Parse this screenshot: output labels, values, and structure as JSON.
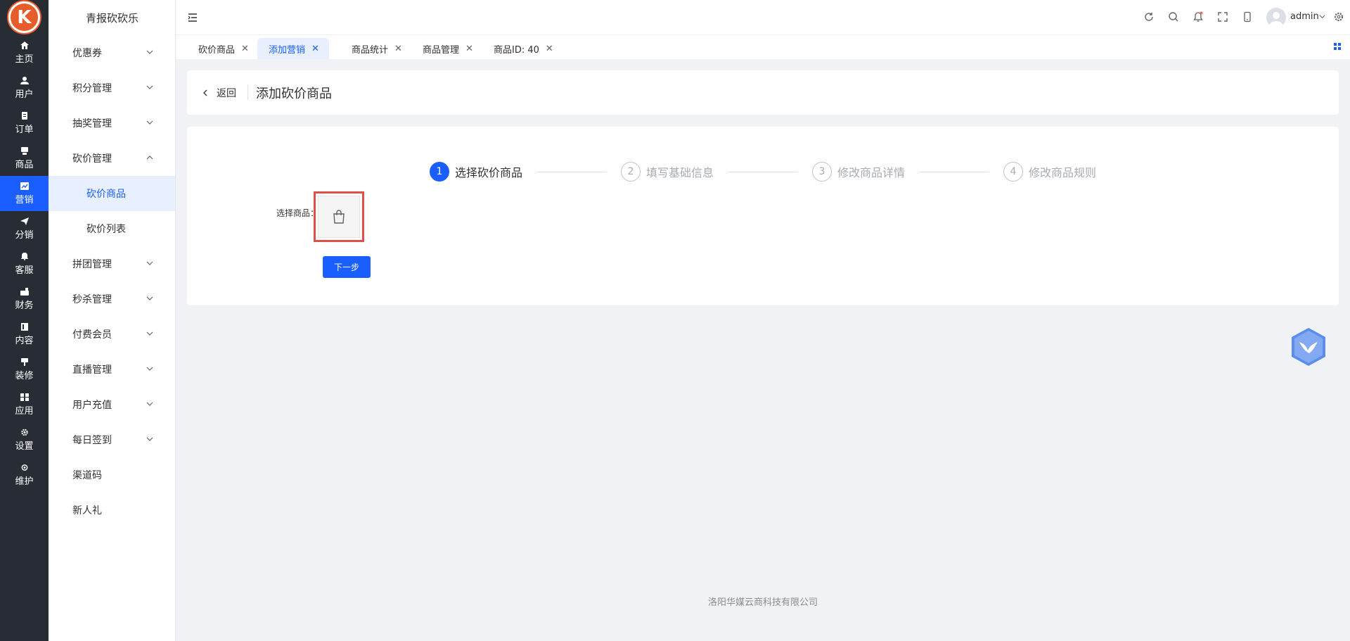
{
  "rail": {
    "logo_text": "K",
    "items": [
      {
        "label": "主页",
        "icon": "home-icon"
      },
      {
        "label": "用户",
        "icon": "user-icon"
      },
      {
        "label": "订单",
        "icon": "order-icon"
      },
      {
        "label": "商品",
        "icon": "product-icon"
      },
      {
        "label": "营销",
        "icon": "marketing-icon"
      },
      {
        "label": "分销",
        "icon": "distribution-icon"
      },
      {
        "label": "客服",
        "icon": "service-icon"
      },
      {
        "label": "财务",
        "icon": "finance-icon"
      },
      {
        "label": "内容",
        "icon": "content-icon"
      },
      {
        "label": "装修",
        "icon": "decorate-icon"
      },
      {
        "label": "应用",
        "icon": "apps-icon"
      },
      {
        "label": "设置",
        "icon": "settings-icon"
      },
      {
        "label": "维护",
        "icon": "maintenance-icon"
      }
    ]
  },
  "submenu": {
    "brand": "青报砍砍乐",
    "items": [
      {
        "label": "优惠券"
      },
      {
        "label": "积分管理"
      },
      {
        "label": "抽奖管理"
      },
      {
        "label": "砍价管理"
      },
      {
        "label": "砍价商品"
      },
      {
        "label": "砍价列表"
      },
      {
        "label": "拼团管理"
      },
      {
        "label": "秒杀管理"
      },
      {
        "label": "付费会员"
      },
      {
        "label": "直播管理"
      },
      {
        "label": "用户充值"
      },
      {
        "label": "每日签到"
      },
      {
        "label": "渠道码"
      },
      {
        "label": "新人礼"
      }
    ]
  },
  "header": {
    "user_name": "admin"
  },
  "tabs": [
    {
      "label": "砍价商品"
    },
    {
      "label": "添加营销"
    },
    {
      "label": "商品统计"
    },
    {
      "label": "商品管理"
    },
    {
      "label": "商品ID: 40"
    }
  ],
  "page": {
    "back_label": "返回",
    "title": "添加砍价商品"
  },
  "steps": [
    {
      "num": "1",
      "label": "选择砍价商品"
    },
    {
      "num": "2",
      "label": "填写基础信息"
    },
    {
      "num": "3",
      "label": "修改商品详情"
    },
    {
      "num": "4",
      "label": "修改商品规则"
    }
  ],
  "form": {
    "select_label": "选择商品：",
    "next_button": "下一步"
  },
  "footer": {
    "company": "洛阳华媒云商科技有限公司"
  },
  "colors": {
    "accent": "#1a5eff",
    "rail_bg": "#282c34",
    "highlight_border": "#e0504a"
  }
}
